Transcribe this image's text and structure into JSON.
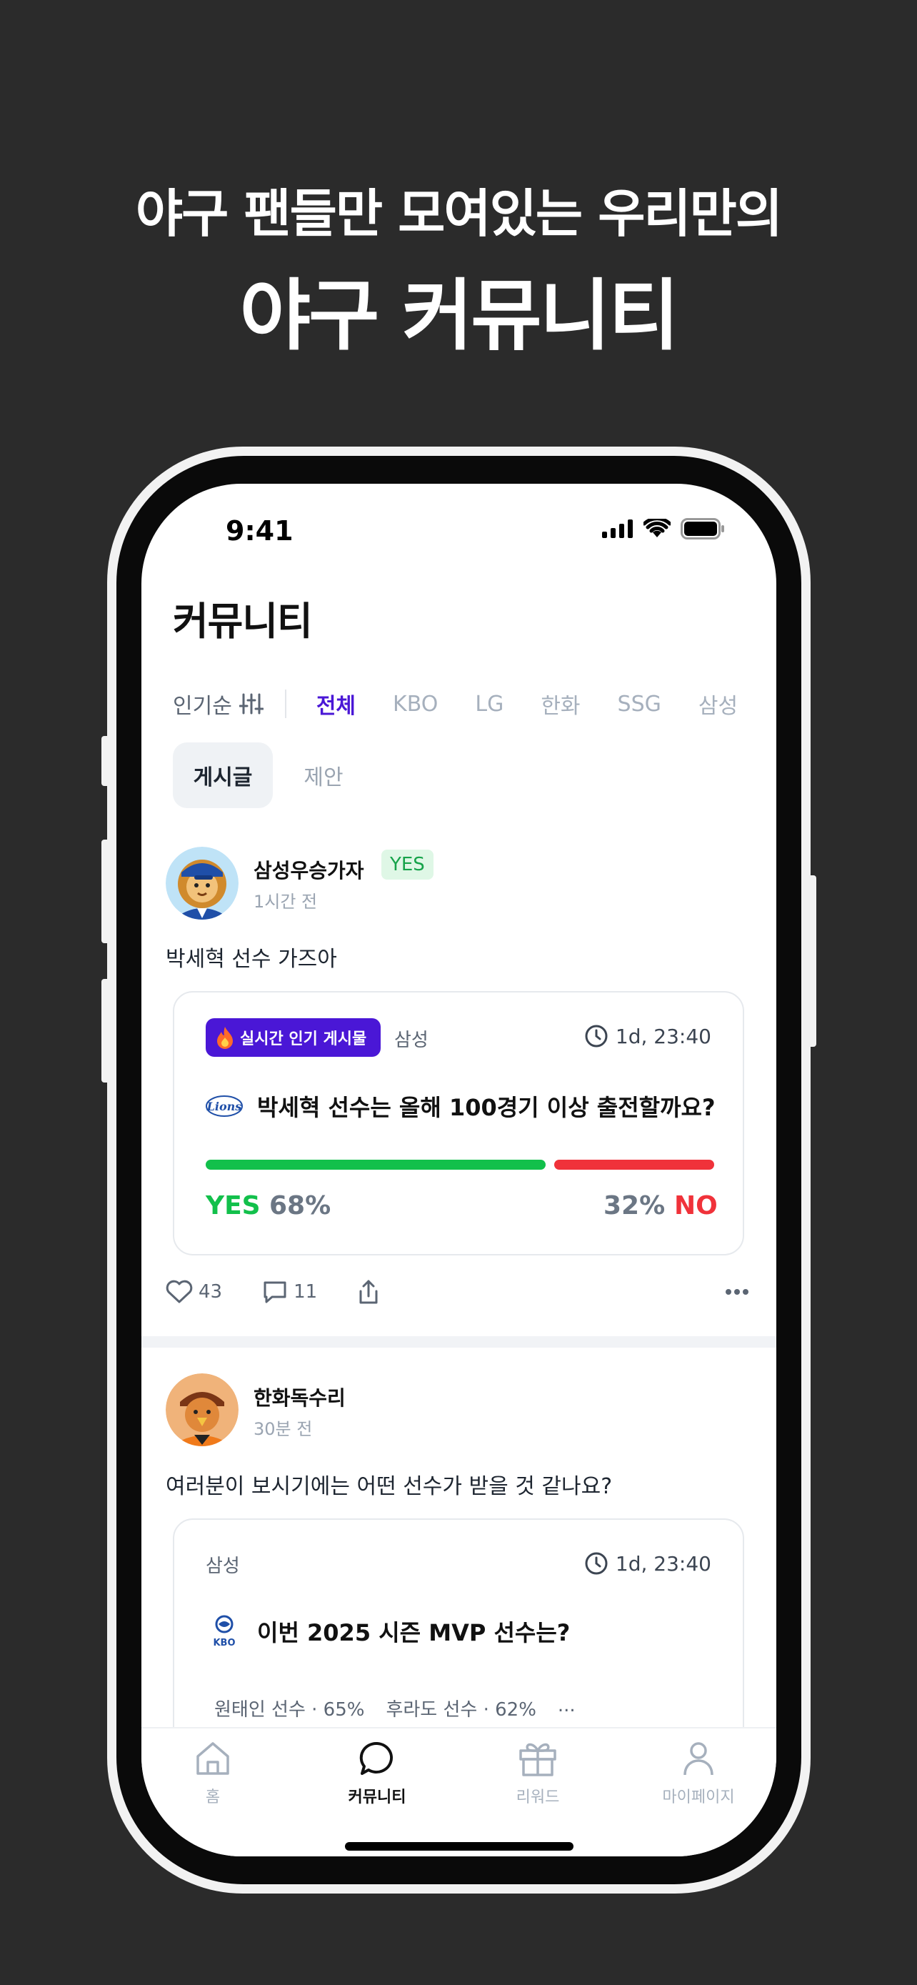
{
  "headline": {
    "line1": "야구 팬들만 모여있는 우리만의",
    "line2": "야구 커뮤니티"
  },
  "status_bar": {
    "time": "9:41"
  },
  "page": {
    "title": "커뮤니티"
  },
  "filters": {
    "sort_label": "인기순",
    "teams": [
      "전체",
      "KBO",
      "LG",
      "한화",
      "SSG",
      "삼성"
    ],
    "active_team": "전체"
  },
  "segments": {
    "post": "게시글",
    "suggest": "제안",
    "active": "게시글"
  },
  "posts": [
    {
      "username": "삼성우승가자",
      "badge": "YES",
      "time_ago": "1시간 전",
      "text": "박세혁 선수 가즈아",
      "card": {
        "hot_badge": "실시간 인기 게시물",
        "team": "삼성",
        "timer": "1d, 23:40",
        "team_logo": "Lions",
        "question": "박세혁 선수는 올해 100경기 이상 출전할까요?",
        "yes_label": "YES",
        "yes_percent": "68%",
        "yes_value": 68,
        "no_label": "NO",
        "no_percent": "32%",
        "no_value": 32
      },
      "likes": "43",
      "comments": "11"
    },
    {
      "username": "한화독수리",
      "time_ago": "30분 전",
      "text": "여러분이 보시기에는 어떤 선수가 받을 것 같나요?",
      "card": {
        "team": "삼성",
        "timer": "1d, 23:40",
        "question": "이번 2025 시즌 MVP 선수는?",
        "league_logo": "KBO",
        "options": [
          "원태인 선수 · 65%",
          "후라도 선수 · 62%",
          "..."
        ]
      }
    }
  ],
  "tabbar": {
    "items": [
      "홈",
      "커뮤니티",
      "리워드",
      "마이페이지"
    ],
    "active": "커뮤니티"
  },
  "colors": {
    "accent": "#4a17d6",
    "yes": "#12c04b",
    "no": "#f0323a",
    "background": "#2b2b2b"
  }
}
